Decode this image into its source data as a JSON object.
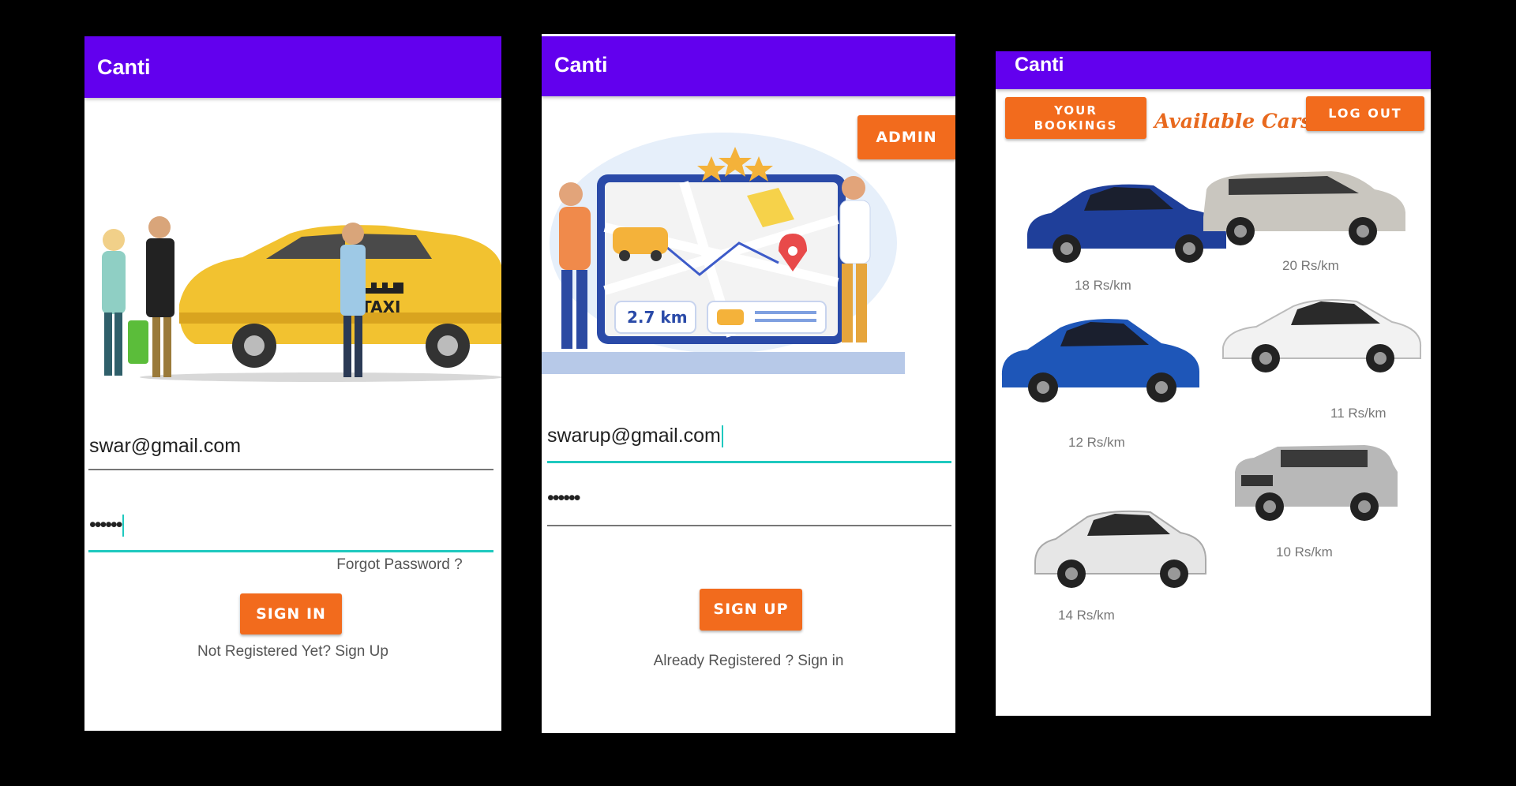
{
  "app": {
    "title": "Canti"
  },
  "signin": {
    "email": "swar@gmail.com",
    "password": "••••••",
    "forgot": "Forgot Password ?",
    "button": "SIGN IN",
    "register_link": "Not Registered Yet? Sign Up"
  },
  "signup": {
    "admin_button": "ADMIN",
    "map_distance": "2.7 km",
    "email": "swarup@gmail.com",
    "password": "••••••",
    "button": "SIGN UP",
    "signin_link": "Already Registered ? Sign in"
  },
  "cars": {
    "bookings_line1": "YOUR",
    "bookings_line2": "BOOKINGS",
    "heading": "Available Cars",
    "logout": "LOG OUT",
    "items": [
      {
        "price": "18 Rs/km",
        "color": "#1f3f9a"
      },
      {
        "price": "20 Rs/km",
        "color": "#c9c6bf"
      },
      {
        "price": "12 Rs/km",
        "color": "#1e56b8"
      },
      {
        "price": "11 Rs/km",
        "color": "#f2f2f2"
      },
      {
        "price": "10 Rs/km",
        "color": "#b8b8b8"
      },
      {
        "price": "14 Rs/km",
        "color": "#e6e6e6"
      }
    ]
  },
  "colors": {
    "appbar": "#6200ee",
    "accent": "#f26b1d",
    "focus": "#1fc9bf"
  }
}
